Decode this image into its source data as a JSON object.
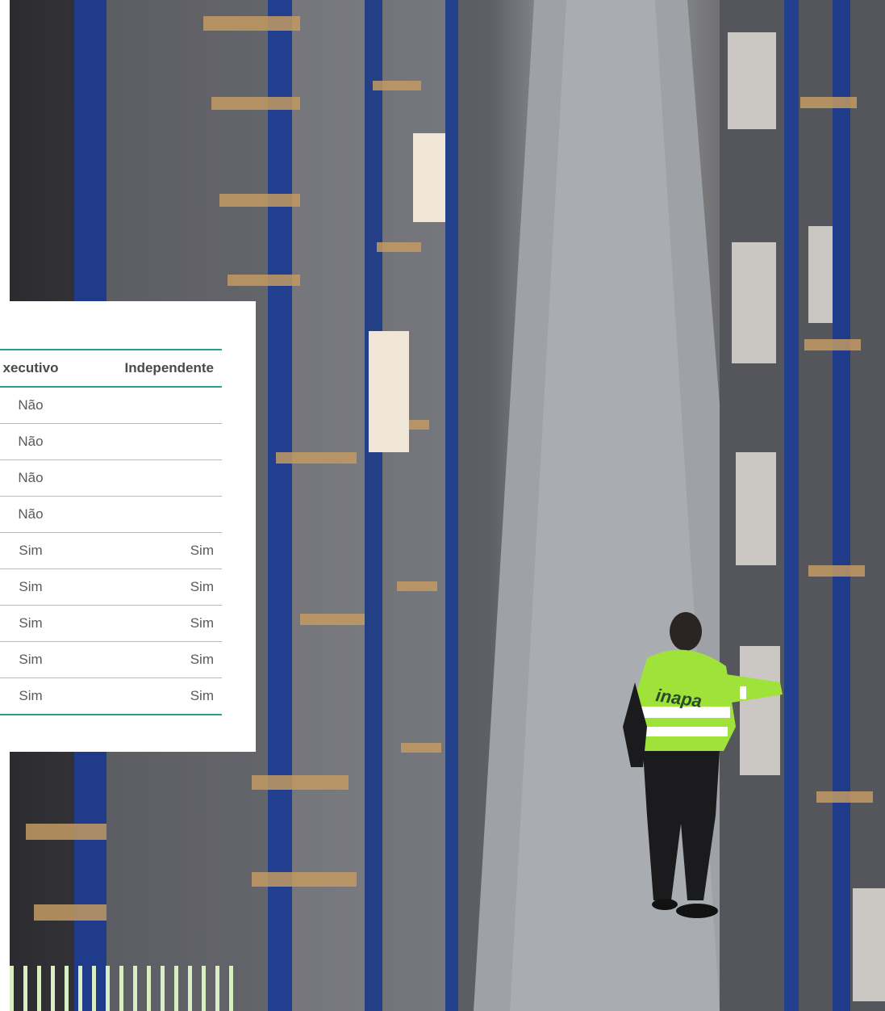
{
  "table": {
    "headers": [
      "xecutivo",
      "Independente"
    ],
    "rows": [
      [
        "Não",
        ""
      ],
      [
        "Não",
        ""
      ],
      [
        "Não",
        ""
      ],
      [
        "Não",
        ""
      ],
      [
        "Sim",
        "Sim"
      ],
      [
        "Sim",
        "Sim"
      ],
      [
        "Sim",
        "Sim"
      ],
      [
        "Sim",
        "Sim"
      ],
      [
        "Sim",
        "Sim"
      ]
    ]
  },
  "photo": {
    "jacket_text": "inapa"
  },
  "colors": {
    "accent": "#2a9d8f",
    "stripe": "#d8efc4",
    "jacket": "#9fe33a"
  }
}
